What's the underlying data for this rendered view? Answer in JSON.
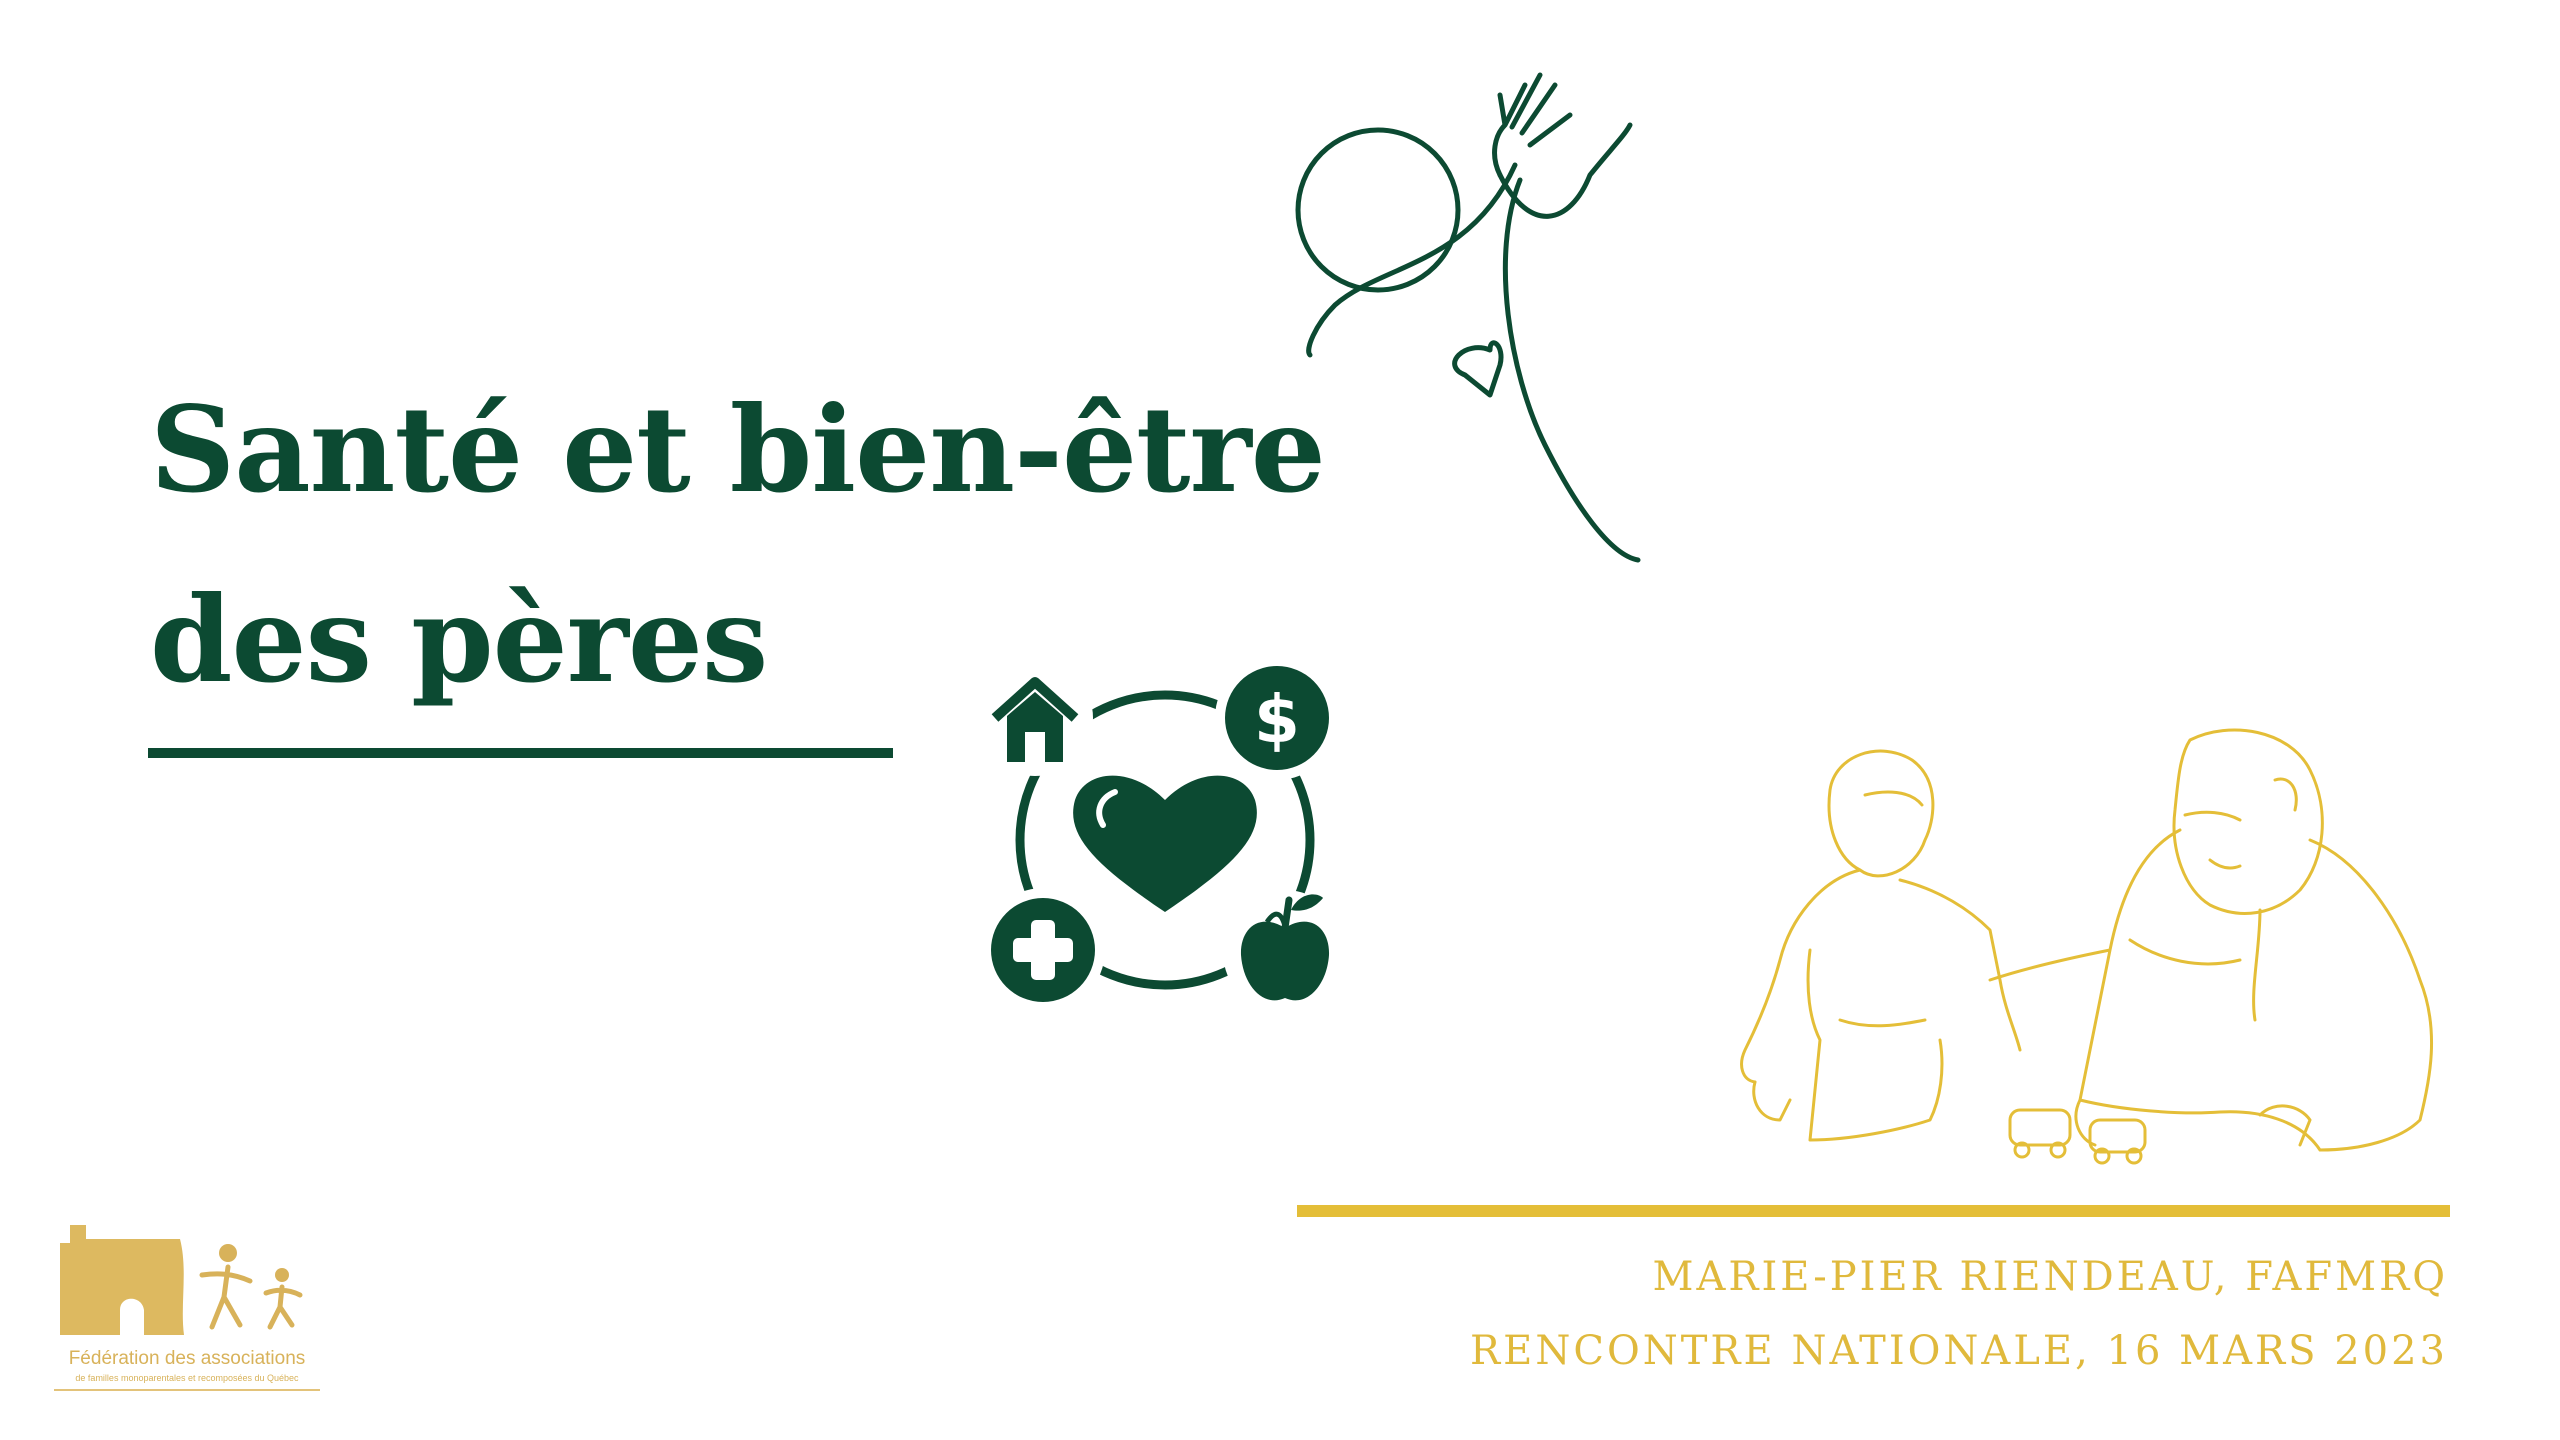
{
  "slide": {
    "title_line1": "Santé et bien-être",
    "title_line2": "des pères",
    "presenter": "MARIE-PIER RIENDEAU, FAFMRQ",
    "event": "RENCONTRE NATIONALE, 16 MARS 2023"
  },
  "logo": {
    "line1": "Fédération des associations",
    "line2": "de familles monoparentales et recomposées du Québec"
  },
  "icons": {
    "top_left": "house-icon",
    "top_right": "dollar-coin-icon",
    "center": "heart-icon",
    "bottom_left": "medical-cross-icon",
    "bottom_right": "apple-icon"
  },
  "colors": {
    "green": "#0c4a32",
    "gold": "#e4be38",
    "logo_gold": "#d8b25a"
  }
}
